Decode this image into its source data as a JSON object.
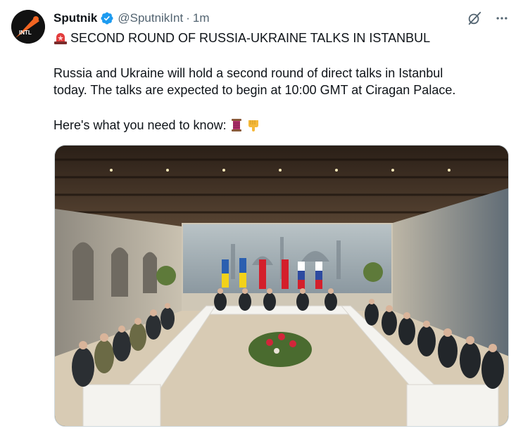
{
  "author": {
    "display_name": "Sputnik",
    "handle": "@SputnikInt",
    "separator": "·",
    "time": "1m",
    "avatar_text": "INTL",
    "verified_icon": "verified-badge-icon"
  },
  "post": {
    "headline": "SECOND ROUND OF RUSSIA-UKRAINE TALKS IN ISTANBUL",
    "headline_icon": "siren-icon",
    "body_line1": "Russia and Ukraine will hold a second round of direct talks in Istanbul",
    "body_line2": "today. The talks are expected to begin at 10:00 GMT at Ciragan Palace.",
    "know_text": "Here's what you need to know:",
    "know_icons": [
      "thread-spool-icon",
      "pointing-down-icon"
    ]
  },
  "actions": {
    "icons": [
      "grok-icon",
      "more-icon"
    ]
  },
  "media": {
    "kind": "photo",
    "colors": {
      "ukraine_blue": "#2b5fb0",
      "ukraine_yellow": "#f3d21a",
      "turkey_red": "#d41f2b",
      "russia_blue": "#2d4aa0",
      "tablecloth": "#f4f3ef",
      "carpet": "#d8cbb4"
    }
  }
}
